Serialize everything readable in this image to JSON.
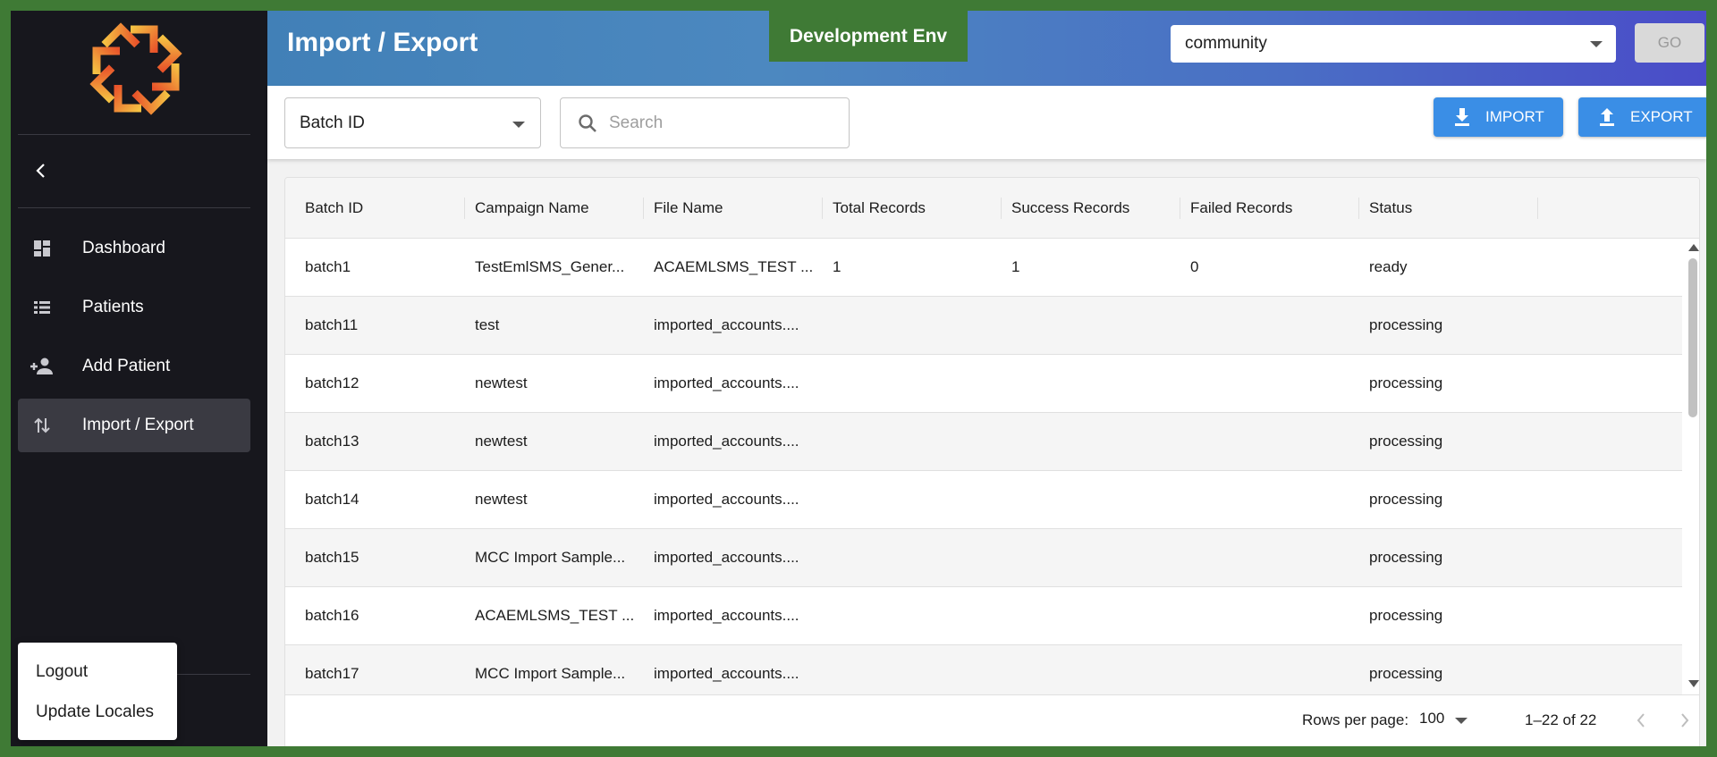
{
  "header": {
    "title": "Import / Export",
    "env_badge": "Development Env",
    "org_select": {
      "value": "community"
    },
    "go_label": "GO"
  },
  "sidebar": {
    "items": [
      {
        "label": "Dashboard",
        "icon": "dashboard-icon"
      },
      {
        "label": "Patients",
        "icon": "list-icon"
      },
      {
        "label": "Add Patient",
        "icon": "person-add-icon"
      },
      {
        "label": "Import / Export",
        "icon": "swap-vert-icon",
        "active": true
      }
    ],
    "popup": {
      "logout": "Logout",
      "update_locales": "Update Locales"
    }
  },
  "toolbar": {
    "filter_value": "Batch ID",
    "search_placeholder": "Search",
    "import_label": "IMPORT",
    "export_label": "EXPORT"
  },
  "table": {
    "columns": [
      "Batch ID",
      "Campaign Name",
      "File Name",
      "Total Records",
      "Success Records",
      "Failed Records",
      "Status"
    ],
    "rows": [
      [
        "batch1",
        "TestEmlSMS_Gener...",
        "ACAEMLSMS_TEST ...",
        "1",
        "1",
        "0",
        "ready"
      ],
      [
        "batch11",
        "test",
        "imported_accounts....",
        "",
        "",
        "",
        "processing"
      ],
      [
        "batch12",
        "newtest",
        "imported_accounts....",
        "",
        "",
        "",
        "processing"
      ],
      [
        "batch13",
        "newtest",
        "imported_accounts....",
        "",
        "",
        "",
        "processing"
      ],
      [
        "batch14",
        "newtest",
        "imported_accounts....",
        "",
        "",
        "",
        "processing"
      ],
      [
        "batch15",
        "MCC Import Sample...",
        "imported_accounts....",
        "",
        "",
        "",
        "processing"
      ],
      [
        "batch16",
        "ACAEMLSMS_TEST ...",
        "imported_accounts....",
        "",
        "",
        "",
        "processing"
      ],
      [
        "batch17",
        "MCC Import Sample...",
        "imported_accounts....",
        "",
        "",
        "",
        "processing"
      ]
    ]
  },
  "pagination": {
    "rows_per_page_label": "Rows per page:",
    "rows_per_page": "100",
    "range": "1–22 of 22"
  },
  "colors": {
    "sidebar_bg": "#17171d",
    "accent_button": "#3a8ee6",
    "env_badge": "#3f7a35"
  }
}
